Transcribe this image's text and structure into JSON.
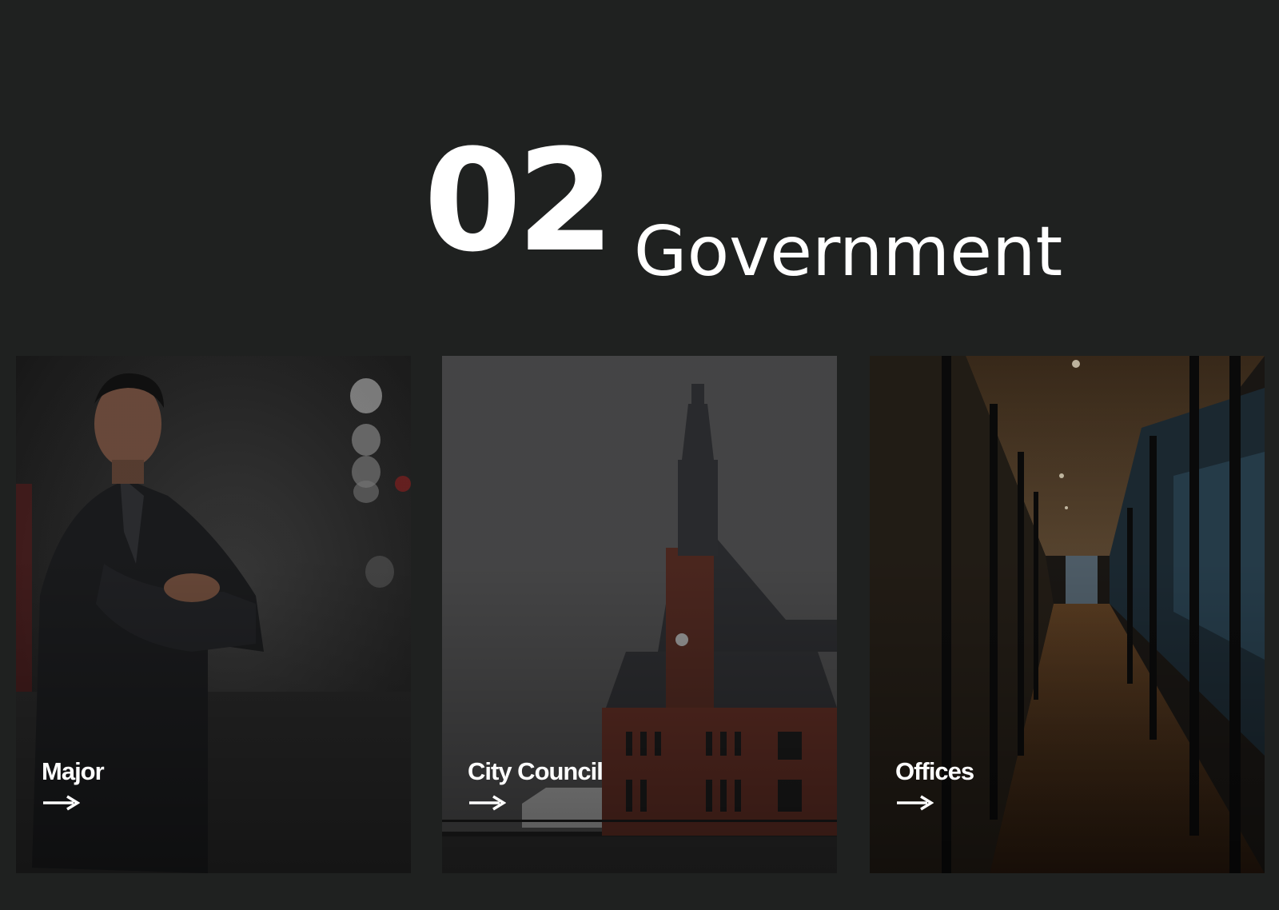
{
  "section": {
    "number": "02",
    "title": "Government"
  },
  "cards": [
    {
      "label": "Major",
      "image": "man-in-suit-arms-crossed-photo",
      "arrow_icon": "arrow-right-icon"
    },
    {
      "label": "City Council",
      "image": "historic-brick-building-clock-tower-photo",
      "arrow_icon": "arrow-right-icon"
    },
    {
      "label": "Offices",
      "image": "office-glass-corridor-photo",
      "arrow_icon": "arrow-right-icon"
    }
  ],
  "colors": {
    "background": "#1f2120",
    "text": "#ffffff"
  }
}
